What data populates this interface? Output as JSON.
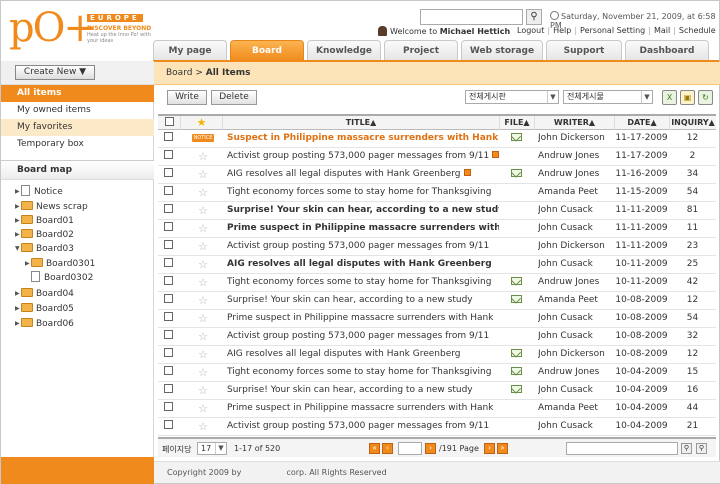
{
  "brand": {
    "logo_text": "pO+",
    "region": "EUROPE",
    "tagline_main": "DISCOVER BEYOND",
    "tagline_sub": "Heat up the Inno Po! with your ideas"
  },
  "header": {
    "date": "Saturday, November 21, 2009, at 6:58 PM",
    "welcome_prefix": "Welcome to",
    "user_name": "Michael Hettich",
    "links": [
      "Logout",
      "Help",
      "Personal Setting",
      "Mail",
      "Schedule"
    ]
  },
  "tabs": [
    {
      "label": "My page",
      "active": false
    },
    {
      "label": "Board",
      "active": true
    },
    {
      "label": "Knowledge",
      "active": false
    },
    {
      "label": "Project",
      "active": false
    },
    {
      "label": "Web storage",
      "active": false
    },
    {
      "label": "Support",
      "active": false
    },
    {
      "label": "Dashboard",
      "active": false
    }
  ],
  "sidebar": {
    "create_label": "Create New ▼",
    "nav": [
      {
        "label": "All items",
        "active": true
      },
      {
        "label": "My owned items",
        "active": false
      },
      {
        "label": "My favorites",
        "active": false
      },
      {
        "label": "Temporary box",
        "active": false
      }
    ],
    "board_map_title": "Board map",
    "tree": [
      "Notice",
      "News scrap",
      "Board01",
      "Board02",
      "Board03",
      "Board0301",
      "Board0302",
      "Board04",
      "Board05",
      "Board06"
    ]
  },
  "breadcrumb": {
    "root": "Board",
    "sep": ">",
    "current": "All Items"
  },
  "toolbar": {
    "write_label": "Write",
    "delete_label": "Delete",
    "select1": "전체게시판",
    "select2": "전체게시물"
  },
  "table": {
    "headers": {
      "title": "TITLE▲",
      "file": "FILE▲",
      "writer": "WRITER▲",
      "date": "DATE▲",
      "inquiry": "INQUIRY▲"
    },
    "notice_badge": "NOTICE",
    "rows": [
      {
        "title": "Suspect in Philippine massacre surrenders with Hank",
        "writer": "John Dickerson",
        "date": "11-17-2009",
        "inquiry": "12"
      },
      {
        "title": "Activist group posting 573,000 pager messages from 9/11",
        "writer": "Andruw Jones",
        "date": "11-17-2009",
        "inquiry": "2"
      },
      {
        "title": "AIG resolves all legal disputes with Hank Greenberg",
        "writer": "Andruw Jones",
        "date": "11-16-2009",
        "inquiry": "34"
      },
      {
        "title": "Tight economy forces some to stay home for Thanksgiving",
        "writer": "Amanda Peet",
        "date": "11-15-2009",
        "inquiry": "54"
      },
      {
        "title": "Surprise! Your skin can hear, according to a new study",
        "writer": "John Cusack",
        "date": "11-11-2009",
        "inquiry": "81"
      },
      {
        "title": "Prime suspect in Philippine massacre surrenders with Hank",
        "writer": "John Cusack",
        "date": "11-11-2009",
        "inquiry": "11"
      },
      {
        "title": "Activist group posting 573,000 pager messages from 9/11",
        "writer": "John Dickerson",
        "date": "11-11-2009",
        "inquiry": "23"
      },
      {
        "title": "AIG resolves all legal disputes with Hank Greenberg",
        "writer": "John Cusack",
        "date": "10-11-2009",
        "inquiry": "25"
      },
      {
        "title": "Tight economy forces some to stay home for Thanksgiving",
        "writer": "Andruw Jones",
        "date": "10-11-2009",
        "inquiry": "42"
      },
      {
        "title": "Surprise! Your skin can hear, according to a new study",
        "writer": "Amanda Peet",
        "date": "10-08-2009",
        "inquiry": "12"
      },
      {
        "title": "Prime suspect in Philippine massacre surrenders with Hank",
        "writer": "John Cusack",
        "date": "10-08-2009",
        "inquiry": "54"
      },
      {
        "title": "Activist group posting 573,000 pager messages from 9/11",
        "writer": "John Cusack",
        "date": "10-08-2009",
        "inquiry": "32"
      },
      {
        "title": "AIG resolves all legal disputes with Hank Greenberg",
        "writer": "John Dickerson",
        "date": "10-08-2009",
        "inquiry": "12"
      },
      {
        "title": "Tight economy forces some to stay home for Thanksgiving",
        "writer": "Andruw Jones",
        "date": "10-04-2009",
        "inquiry": "15"
      },
      {
        "title": "Surprise! Your skin can hear, according to a new study",
        "writer": "John Cusack",
        "date": "10-04-2009",
        "inquiry": "16"
      },
      {
        "title": "Prime suspect in Philippine massacre surrenders with Hank",
        "writer": "Amanda Peet",
        "date": "10-04-2009",
        "inquiry": "44"
      },
      {
        "title": "Activist group posting 573,000 pager messages from 9/11",
        "writer": "John Cusack",
        "date": "10-04-2009",
        "inquiry": "21"
      }
    ]
  },
  "pager": {
    "per_page_label": "페이지당",
    "per_page_value": "17",
    "range": "1-17 of 520",
    "total_pages": "/191 Page"
  },
  "footer": {
    "copyright": "Copyright 2009 by",
    "rights": "corp. All Rights Reserved"
  },
  "colors": {
    "accent": "#f08a1c",
    "breadcrumb_bg": "#fde4b8"
  }
}
